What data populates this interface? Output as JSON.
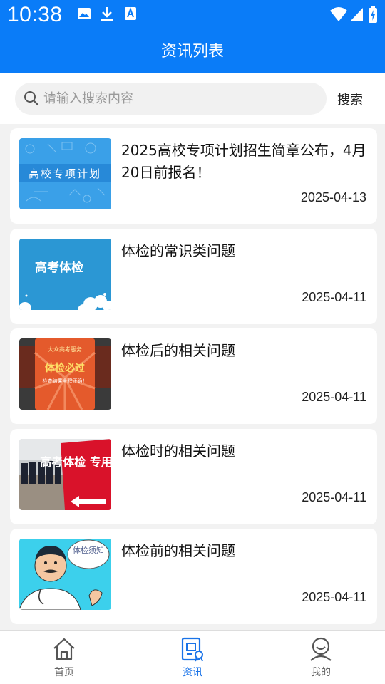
{
  "status_bar": {
    "time": "10:38"
  },
  "header": {
    "title": "资讯列表"
  },
  "search": {
    "placeholder": "请输入搜索内容",
    "button_label": "搜索"
  },
  "news": [
    {
      "title": "2025高校专项计划招生简章公布，4月20日前报名！",
      "date": "2025-04-13",
      "thumb_text": "高校专项计划",
      "thumb": "planning"
    },
    {
      "title": "体检的常识类问题",
      "date": "2025-04-11",
      "thumb_text": "高考体检",
      "thumb": "clouds"
    },
    {
      "title": "体检后的相关问题",
      "date": "2025-04-11",
      "thumb_text": "体检必过",
      "thumb": "poster"
    },
    {
      "title": "体检时的相关问题",
      "date": "2025-04-11",
      "thumb_text": "高考体检 专用通道",
      "thumb": "sign"
    },
    {
      "title": "体检前的相关问题",
      "date": "2025-04-11",
      "thumb_text": "体检须知",
      "thumb": "doctor"
    }
  ],
  "tabbar": [
    {
      "label": "首页",
      "icon": "home-icon",
      "active": false
    },
    {
      "label": "资讯",
      "icon": "news-icon",
      "active": true
    },
    {
      "label": "我的",
      "icon": "profile-icon",
      "active": false
    }
  ],
  "colors": {
    "primary": "#0a7cf8",
    "active_tab": "#1a73e8"
  }
}
